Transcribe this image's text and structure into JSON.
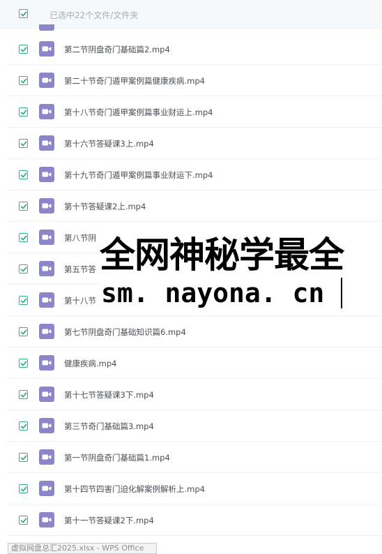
{
  "header": {
    "selection_text": "已选中22个文件/文件夹",
    "checked": true
  },
  "colors": {
    "check_green": "#2fb389",
    "video_icon_purple": "#8a86c9"
  },
  "files": [
    {
      "name": "第二节阴盘奇门基础篇2.mp4",
      "icon": "video-icon",
      "checked": true
    },
    {
      "name": "第二十节奇门遁甲案例篇健康疾病.mp4",
      "icon": "video-icon",
      "checked": true
    },
    {
      "name": "第十八节奇门遁甲案例篇事业财运上.mp4",
      "icon": "video-icon",
      "checked": true
    },
    {
      "name": "第十六节答疑课3上.mp4",
      "icon": "video-icon",
      "checked": true
    },
    {
      "name": "第十九节奇门遁甲案例篇事业财运下.mp4",
      "icon": "video-icon",
      "checked": true
    },
    {
      "name": "第十节答疑课2上.mp4",
      "icon": "video-icon",
      "checked": true
    },
    {
      "name": "第八节阴",
      "icon": "video-icon",
      "checked": true
    },
    {
      "name": "第五节答",
      "icon": "video-icon",
      "checked": true
    },
    {
      "name": "第十八节",
      "icon": "video-icon",
      "checked": true
    },
    {
      "name": "第七节阴盘奇门基础知识篇6.mp4",
      "icon": "video-icon",
      "checked": true
    },
    {
      "name": "健康疾病.mp4",
      "icon": "video-icon",
      "checked": true
    },
    {
      "name": "第十七节答疑课3下.mp4",
      "icon": "video-icon",
      "checked": true
    },
    {
      "name": "第三节奇门基础篇3.mp4",
      "icon": "video-icon",
      "checked": true
    },
    {
      "name": "第一节阴盘奇门基础篇1.mp4",
      "icon": "video-icon",
      "checked": true
    },
    {
      "name": "第十四节四害门迫化解案例解析上.mp4",
      "icon": "video-icon",
      "checked": true
    },
    {
      "name": "第十一节答疑课2下.mp4",
      "icon": "video-icon",
      "checked": true
    }
  ],
  "watermark": {
    "line1": "全网神秘学最全",
    "line2": "sm. nayona. cn"
  },
  "taskbar_tip": "虚拟网盘总汇2025.xlsx - WPS Office"
}
